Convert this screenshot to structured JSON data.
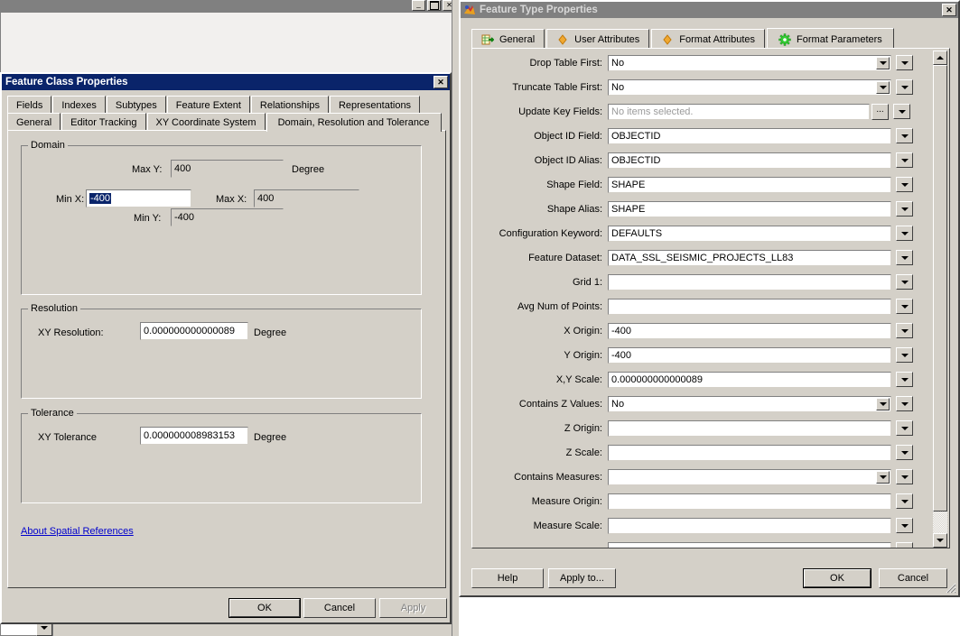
{
  "background_window": {
    "minimize_label": "_",
    "maximize_label": "❐",
    "close_label": "✕"
  },
  "dialog_feature_class": {
    "title": "Feature Class Properties",
    "close_label": "✕",
    "tabs_row1": [
      {
        "label": "Fields",
        "active": false
      },
      {
        "label": "Indexes",
        "active": false
      },
      {
        "label": "Subtypes",
        "active": false
      },
      {
        "label": "Feature Extent",
        "active": false
      },
      {
        "label": "Relationships",
        "active": false
      },
      {
        "label": "Representations",
        "active": false
      }
    ],
    "tabs_row2": [
      {
        "label": "General",
        "active": false
      },
      {
        "label": "Editor Tracking",
        "active": false
      },
      {
        "label": "XY Coordinate System",
        "active": false
      },
      {
        "label": "Domain, Resolution and Tolerance",
        "active": true
      }
    ],
    "domain": {
      "caption": "Domain",
      "max_y_label": "Max Y:",
      "max_y_value": "400",
      "max_y_unit": "Degree",
      "min_x_label": "Min X:",
      "min_x_value": "-400",
      "max_x_label": "Max X:",
      "max_x_value": "400",
      "min_y_label": "Min Y:",
      "min_y_value": "-400"
    },
    "resolution": {
      "caption": "Resolution",
      "xy_resolution_label": "XY Resolution:",
      "xy_resolution_value": "0.000000000000089",
      "xy_resolution_unit": "Degree"
    },
    "tolerance": {
      "caption": "Tolerance",
      "xy_tolerance_label": "XY Tolerance",
      "xy_tolerance_value": "0.000000008983153",
      "xy_tolerance_unit": "Degree"
    },
    "about_link": "About Spatial References",
    "buttons": {
      "ok": "OK",
      "cancel": "Cancel",
      "apply": "Apply"
    }
  },
  "dialog_feature_type": {
    "title": "Feature Type Properties",
    "close_label": "✕",
    "tabs": [
      {
        "label": "General",
        "icon": "table-arrow-icon",
        "active": false
      },
      {
        "label": "User Attributes",
        "icon": "orange-diamond-icon",
        "active": false
      },
      {
        "label": "Format Attributes",
        "icon": "orange-diamond-icon",
        "active": false
      },
      {
        "label": "Format Parameters",
        "icon": "green-gear-icon",
        "active": true
      }
    ],
    "parameters": [
      {
        "label": "Drop Table First:",
        "value": "No",
        "type": "combo",
        "placeholder": ""
      },
      {
        "label": "Truncate Table First:",
        "value": "No",
        "type": "combo",
        "placeholder": ""
      },
      {
        "label": "Update Key Fields:",
        "value": "",
        "type": "picker",
        "placeholder": "No items selected."
      },
      {
        "label": "Object ID Field:",
        "value": "OBJECTID",
        "type": "text",
        "placeholder": ""
      },
      {
        "label": "Object ID Alias:",
        "value": "OBJECTID",
        "type": "text",
        "placeholder": ""
      },
      {
        "label": "Shape Field:",
        "value": "SHAPE",
        "type": "text",
        "placeholder": ""
      },
      {
        "label": "Shape Alias:",
        "value": "SHAPE",
        "type": "text",
        "placeholder": ""
      },
      {
        "label": "Configuration Keyword:",
        "value": "DEFAULTS",
        "type": "text",
        "placeholder": ""
      },
      {
        "label": "Feature Dataset:",
        "value": "DATA_SSL_SEISMIC_PROJECTS_LL83",
        "type": "text",
        "placeholder": ""
      },
      {
        "label": "Grid 1:",
        "value": "",
        "type": "text",
        "placeholder": ""
      },
      {
        "label": "Avg Num of Points:",
        "value": "",
        "type": "text",
        "placeholder": ""
      },
      {
        "label": "X Origin:",
        "value": "-400",
        "type": "text",
        "placeholder": ""
      },
      {
        "label": "Y Origin:",
        "value": "-400",
        "type": "text",
        "placeholder": ""
      },
      {
        "label": "X,Y Scale:",
        "value": "0.000000000000089",
        "type": "text",
        "placeholder": ""
      },
      {
        "label": "Contains Z Values:",
        "value": "No",
        "type": "combo",
        "placeholder": ""
      },
      {
        "label": "Z Origin:",
        "value": "",
        "type": "text",
        "placeholder": ""
      },
      {
        "label": "Z Scale:",
        "value": "",
        "type": "text",
        "placeholder": ""
      },
      {
        "label": "Contains Measures:",
        "value": "",
        "type": "combo",
        "placeholder": ""
      },
      {
        "label": "Measure Origin:",
        "value": "",
        "type": "text",
        "placeholder": ""
      },
      {
        "label": "Measure Scale:",
        "value": "",
        "type": "text",
        "placeholder": ""
      },
      {
        "label": "",
        "value": "",
        "type": "text",
        "placeholder": ""
      }
    ],
    "ellipsis_label": "...",
    "buttons": {
      "help": "Help",
      "apply_to": "Apply to...",
      "ok": "OK",
      "cancel": "Cancel"
    }
  },
  "colors": {
    "active_titlebar": "#0a246a",
    "inactive_titlebar": "#808080",
    "dialog_face": "#d4d0c8",
    "selection": "#0a246a",
    "link": "#0000cc",
    "gear_green": "#33cc33",
    "diamond_orange": "#f0a830"
  }
}
